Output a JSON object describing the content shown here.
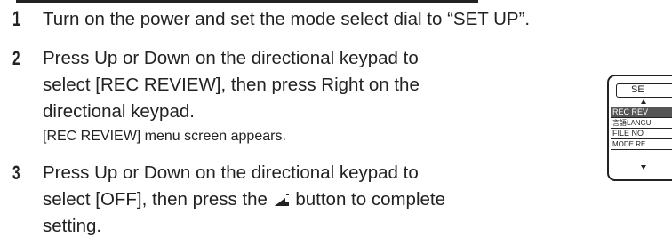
{
  "steps": [
    {
      "number": "1",
      "lines": [
        "Turn on the power and set the mode select dial to “SET UP”."
      ]
    },
    {
      "number": "2",
      "lines": [
        "Press Up or Down on the directional keypad to",
        "select [REC REVIEW], then press Right on the",
        "directional keypad."
      ],
      "note": "[REC REVIEW] menu screen appears."
    },
    {
      "number": "3",
      "line1": "Press Up or Down on the directional keypad to",
      "line2_before": "select [OFF], then press the",
      "line2_after": "button to complete",
      "line3": "setting."
    }
  ],
  "lcd": {
    "title": "SE",
    "items": [
      "REC REV",
      "言語LANGU",
      "FILE NO",
      "MODE RE"
    ]
  }
}
